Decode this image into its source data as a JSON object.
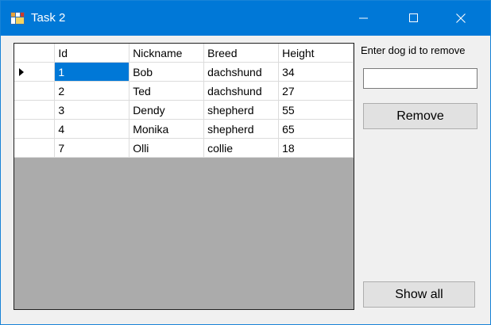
{
  "window": {
    "title": "Task 2"
  },
  "grid": {
    "columns": [
      "Id",
      "Nickname",
      "Breed",
      "Height"
    ],
    "rows": [
      [
        "1",
        "Bob",
        "dachshund",
        "34"
      ],
      [
        "2",
        "Ted",
        "dachshund",
        "27"
      ],
      [
        "3",
        "Dendy",
        "shepherd",
        "55"
      ],
      [
        "4",
        "Monika",
        "shepherd",
        "65"
      ],
      [
        "7",
        "Olli",
        "collie",
        "18"
      ]
    ]
  },
  "side": {
    "prompt_label": "Enter dog id to remove",
    "id_value": "",
    "remove_label": "Remove",
    "show_all_label": "Show all"
  }
}
